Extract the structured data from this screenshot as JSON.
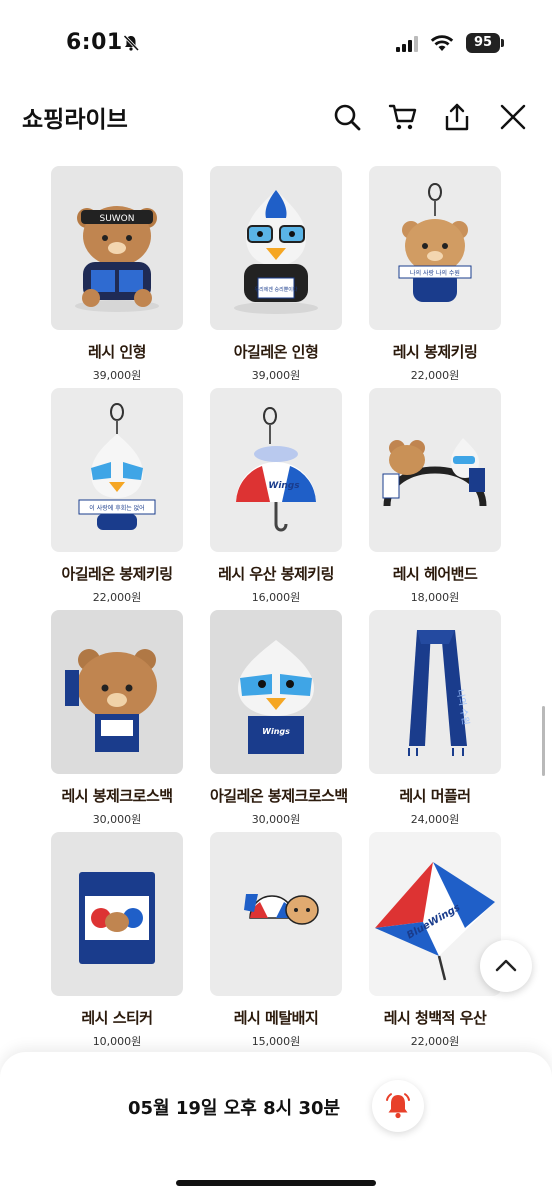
{
  "status": {
    "time": "6:01",
    "battery": "95"
  },
  "header": {
    "title": "쇼핑라이브"
  },
  "products": [
    {
      "name": "레시 인형",
      "price": "39,000원"
    },
    {
      "name": "아길레온 인형",
      "price": "39,000원"
    },
    {
      "name": "레시 봉제키링",
      "price": "22,000원"
    },
    {
      "name": "아길레온 봉제키링",
      "price": "22,000원"
    },
    {
      "name": "레시 우산 봉제키링",
      "price": "16,000원"
    },
    {
      "name": "레시 헤어밴드",
      "price": "18,000원"
    },
    {
      "name": "레시 봉제크로스백",
      "price": "30,000원"
    },
    {
      "name": "아길레온 봉제크로스백",
      "price": "30,000원"
    },
    {
      "name": "레시 머플러",
      "price": "24,000원"
    },
    {
      "name": "레시 스티커",
      "price": "10,000원"
    },
    {
      "name": "레시 메탈배지",
      "price": "15,000원"
    },
    {
      "name": "레시 청백적 우산",
      "price": "22,000원"
    }
  ],
  "product_labels": {
    "headband_brand": "SUWON",
    "plush_sign": "우리에겐 승리뿐이다",
    "keyring_scarf": "나의 사랑 나의 수원",
    "aquila_scarf": "이 사랑에 후회는 없어",
    "umbrella_brand": "Wings",
    "muffler_text": "나의 수원",
    "big_umbrella_brand": "BlueWings"
  },
  "bottom": {
    "schedule": "05월 19일 오후 8시 30분"
  },
  "colors": {
    "accent": "#e8402a",
    "text": "#2b1a0c",
    "blue": "#1a3c8c"
  }
}
